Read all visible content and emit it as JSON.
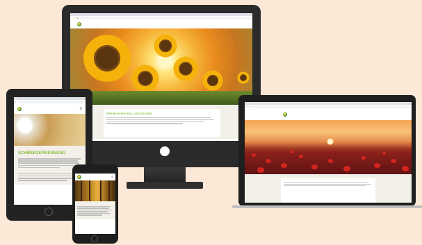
{
  "site": {
    "logo_text": "",
    "url": "",
    "tab_title": ""
  },
  "monitor": {
    "nav_items": [
      {
        "label": "",
        "active": true
      },
      {
        "label": "",
        "active": false
      },
      {
        "label": "",
        "active": false
      },
      {
        "label": "",
        "active": false
      },
      {
        "label": "",
        "active": false
      }
    ],
    "section_heading": "FREIBURGER PALLIATIVSZENE"
  },
  "tablet": {
    "logo_text": "",
    "heading": "SCHMERZERKENNUNG",
    "subheading": ""
  },
  "laptop": {
    "nav_items": [
      {
        "label": "",
        "active": false
      },
      {
        "label": "",
        "active": false
      },
      {
        "label": "",
        "active": true
      },
      {
        "label": "",
        "active": false
      },
      {
        "label": "",
        "active": false
      }
    ],
    "section_heading": ""
  },
  "phone": {
    "heading_line1": "",
    "heading_line2": ""
  },
  "colors": {
    "accent": "#8cbf3f",
    "background": "#fce8d6",
    "device_frame": "#2b2b2b",
    "content_bg": "#f3f0ea"
  },
  "icons": [
    "hamburger-menu-icon",
    "back-arrow-icon",
    "forward-arrow-icon",
    "reload-icon",
    "logo-icon"
  ]
}
